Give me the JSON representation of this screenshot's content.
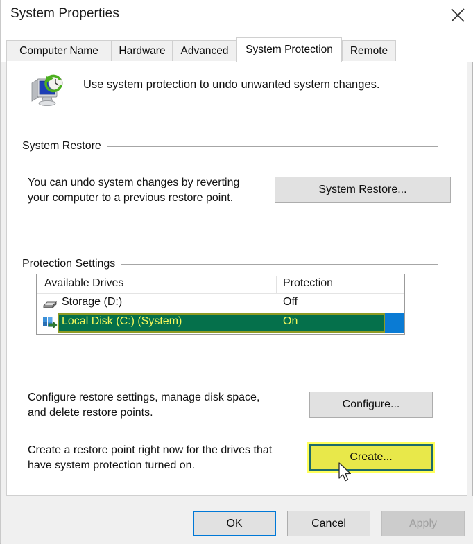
{
  "window": {
    "title": "System Properties",
    "close_icon": "close-x-icon"
  },
  "tabs": [
    {
      "label": "Computer Name",
      "active": false
    },
    {
      "label": "Hardware",
      "active": false
    },
    {
      "label": "Advanced",
      "active": false
    },
    {
      "label": "System Protection",
      "active": true
    },
    {
      "label": "Remote",
      "active": false
    }
  ],
  "header": {
    "icon": "system-restore-icon",
    "description": "Use system protection to undo unwanted system changes."
  },
  "system_restore": {
    "group_label": "System Restore",
    "description_line1": "You can undo system changes by reverting",
    "description_line2": "your computer to a previous restore point.",
    "button_label": "System Restore..."
  },
  "protection_settings": {
    "group_label": "Protection Settings",
    "columns": {
      "drives": "Available Drives",
      "protection": "Protection"
    },
    "rows": [
      {
        "icon": "hard-drive-icon",
        "name": "Storage (D:)",
        "protection": "Off",
        "selected": false
      },
      {
        "icon": "windows-system-drive-icon",
        "name": "Local Disk (C:) (System)",
        "protection": "On",
        "selected": true
      }
    ],
    "configure": {
      "description_line1": "Configure restore settings, manage disk space,",
      "description_line2": "and delete restore points.",
      "button_label": "Configure..."
    },
    "create": {
      "description_line1": "Create a restore point right now for the drives that",
      "description_line2": "have system protection turned on.",
      "button_label": "Create..."
    }
  },
  "footer": {
    "ok_label": "OK",
    "cancel_label": "Cancel",
    "apply_label": "Apply"
  },
  "colors": {
    "accent": "#0078d7",
    "selection_blue": "#0a7bd4",
    "highlight_green": "#05704b",
    "highlight_yellow": "#e8e84a",
    "highlight_text_yellow": "#f6f85b",
    "dialog_bg": "#f0f0f0",
    "page_bg": "#ffffff"
  },
  "cursor": {
    "icon": "mouse-pointer-icon"
  }
}
